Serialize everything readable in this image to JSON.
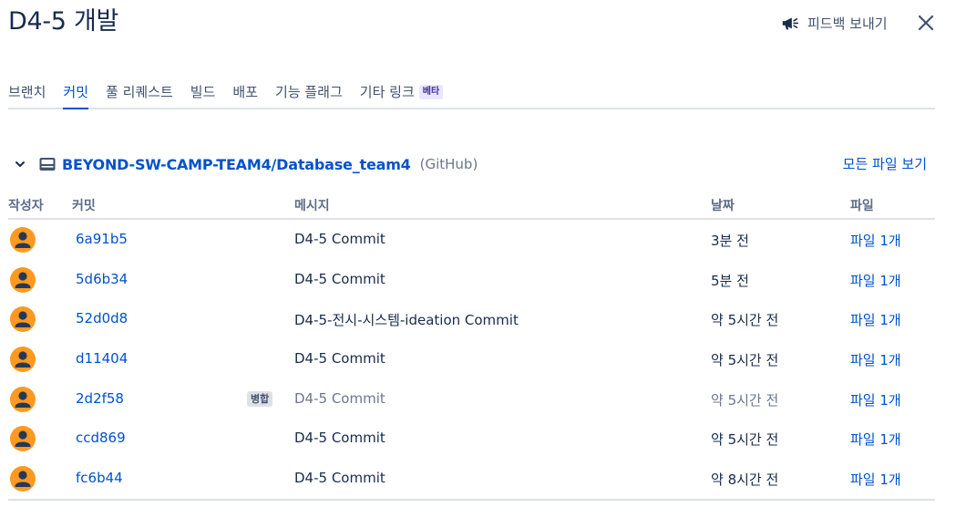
{
  "header": {
    "title": "D4-5 개발",
    "feedback_label": "피드백 보내기"
  },
  "tabs": [
    {
      "label": "브랜치",
      "active": false
    },
    {
      "label": "커밋",
      "active": true
    },
    {
      "label": "풀 리퀘스트",
      "active": false
    },
    {
      "label": "빌드",
      "active": false
    },
    {
      "label": "배포",
      "active": false
    },
    {
      "label": "기능 플래그",
      "active": false
    },
    {
      "label": "기타 링크",
      "active": false,
      "badge": "베타"
    }
  ],
  "repo": {
    "name": "BEYOND-SW-CAMP-TEAM4/Database_team4",
    "source": "(GitHub)",
    "view_all_label": "모든 파일 보기"
  },
  "table": {
    "columns": [
      "작성자",
      "커밋",
      "메시지",
      "날짜",
      "파일"
    ],
    "rows": [
      {
        "hash": "6a91b5",
        "message": "D4-5 Commit",
        "date": "3분 전",
        "files": "파일 1개"
      },
      {
        "hash": "5d6b34",
        "message": "D4-5 Commit",
        "date": "5분 전",
        "files": "파일 1개"
      },
      {
        "hash": "52d0d8",
        "message": "D4-5-전시-시스템-ideation Commit",
        "date": "약 5시간 전",
        "files": "파일 1개"
      },
      {
        "hash": "d11404",
        "message": "D4-5 Commit",
        "date": "약 5시간 전",
        "files": "파일 1개"
      },
      {
        "hash": "2d2f58",
        "merge_badge": "병합",
        "message": "D4-5 Commit",
        "date": "약 5시간 전",
        "files": "파일 1개",
        "dim": true
      },
      {
        "hash": "ccd869",
        "message": "D4-5 Commit",
        "date": "약 5시간 전",
        "files": "파일 1개"
      },
      {
        "hash": "fc6b44",
        "message": "D4-5 Commit",
        "date": "약 8시간 전",
        "files": "파일 1개"
      }
    ]
  },
  "colors": {
    "link": "#0052cc",
    "text": "#172b4d",
    "avatar_bg": "#ff991f",
    "avatar_fg": "#253858",
    "beta_bg": "#eae6ff",
    "beta_fg": "#403294"
  }
}
